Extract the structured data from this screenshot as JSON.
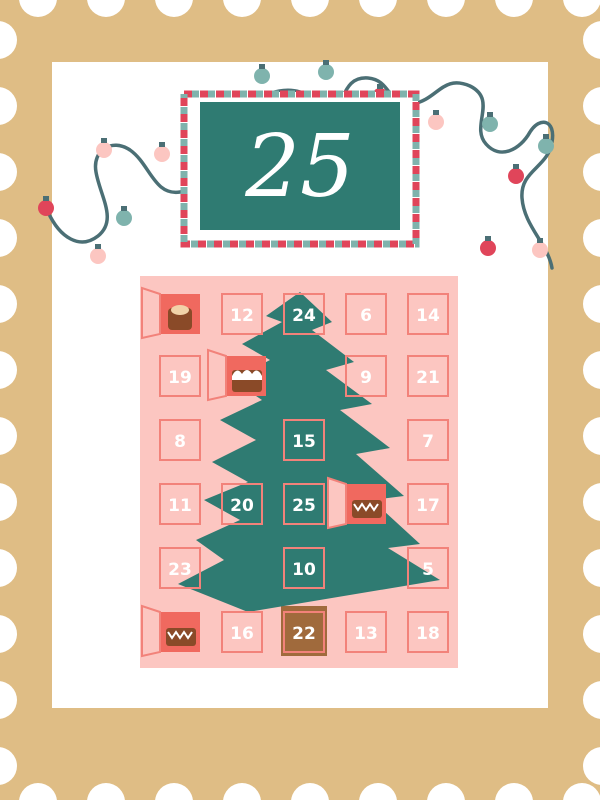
{
  "stamp": {
    "day_number": "25",
    "colors": {
      "stamp_border": "#dfbd85",
      "paper": "#ffffff",
      "calendar_board": "#fcc6c1",
      "door_outline": "#f2827a",
      "tree": "#2f7b72",
      "trunk": "#a06a3c",
      "badge": "#2f7b72",
      "badge_text": "#ffffff",
      "airmail_red": "#e0455a",
      "airmail_teal": "#7fb3ad",
      "open_door": "#f0695f",
      "chocolate": "#8a4a28",
      "lights_wire": "#4b6f75"
    }
  },
  "calendar": {
    "doors": [
      {
        "label": "",
        "open": true,
        "treat": "truffle"
      },
      {
        "label": "12",
        "open": false
      },
      {
        "label": "24",
        "open": false
      },
      {
        "label": "6",
        "open": false
      },
      {
        "label": "14",
        "open": false
      },
      {
        "label": "19",
        "open": false
      },
      {
        "label": "",
        "open": true,
        "treat": "frosted"
      },
      {
        "label": "9",
        "open": false
      },
      {
        "label": "21",
        "open": false
      },
      {
        "label": "8",
        "open": false
      },
      {
        "label": "15",
        "open": false
      },
      {
        "label": "7",
        "open": false
      },
      {
        "label": "11",
        "open": false
      },
      {
        "label": "20",
        "open": false
      },
      {
        "label": "25",
        "open": false
      },
      {
        "label": "",
        "open": true,
        "treat": "zigzag"
      },
      {
        "label": "17",
        "open": false
      },
      {
        "label": "23",
        "open": false
      },
      {
        "label": "10",
        "open": false
      },
      {
        "label": "5",
        "open": false
      },
      {
        "label": "",
        "open": true,
        "treat": "zigzag"
      },
      {
        "label": "16",
        "open": false
      },
      {
        "label": "22",
        "open": false
      },
      {
        "label": "13",
        "open": false
      },
      {
        "label": "18",
        "open": false
      }
    ]
  }
}
